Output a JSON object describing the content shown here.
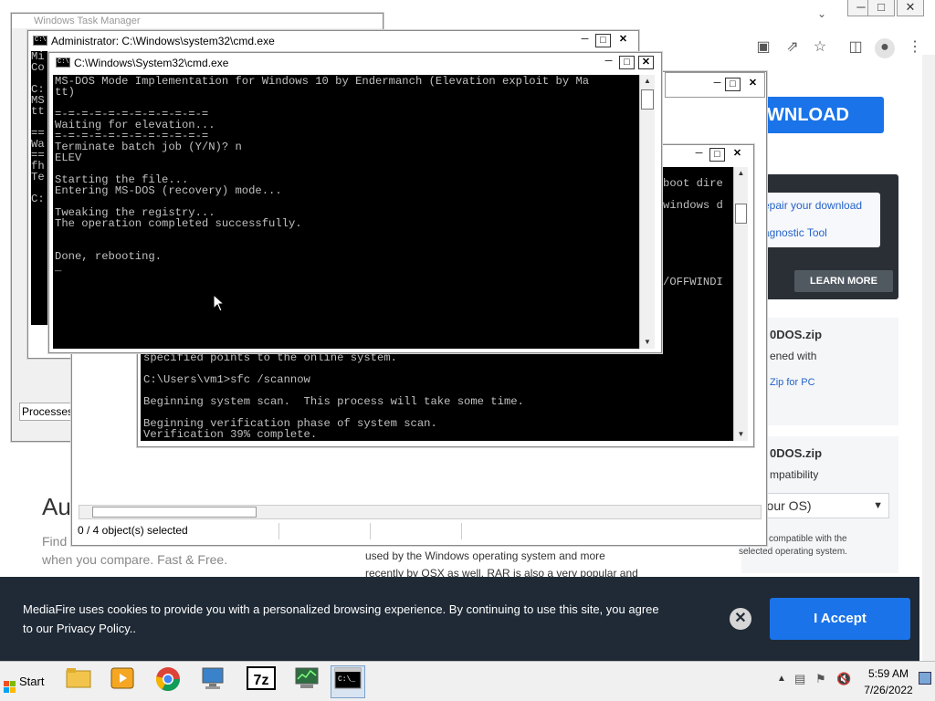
{
  "browser": {
    "download_label": "WNLOAD",
    "repair_link": "epair your download",
    "diag_link": "agnostic Tool",
    "learn_more": "LEARN MORE",
    "card1_title": "0DOS.zip",
    "card1_text": "ened with",
    "card1_link": "Zip for PC",
    "card2_title": "0DOS.zip",
    "card2_text": "mpatibility",
    "os_select": "s (your OS)",
    "compat_note1": "compatible with the",
    "compat_note2": "selected operating system.",
    "left_heading": "Au",
    "left_text1": "Find",
    "left_text2": "when you compare. Fast & Free.",
    "mid_text1": "used by the Windows operating system and more",
    "mid_text2": "recently by OSX as well. RAR is also a very popular and"
  },
  "cookie": {
    "line1": "MediaFire uses cookies to provide you with a personalized browsing experience. By continuing to use this site, you agree",
    "line2": "to our Privacy Policy..",
    "accept": "I Accept"
  },
  "back_windows": {
    "task_manager_title": "Windows Task Manager",
    "processes_label": "Processes:",
    "admin_title": "Administrator: C:\\Windows\\system32\\cmd.exe",
    "admin_console": "Mi\nCo\n\nC:\nMS\ntt\n\n==\nWa\n==\nfh\nTe\n\nC:",
    "explorer_status": "0 / 4 object(s) selected",
    "scan_console": "specified points to the online system.\n\nC:\\Users\\vm1>sfc /scannow\n\nBeginning system scan.  This process will take some time.\n\nBeginning verification phase of system scan.\nVerification 39% complete.",
    "scan_right_console": "boot dire\n\nwindows d\n\n\n\n\n\n\n/OFFWINDI"
  },
  "front_cmd": {
    "title": "C:\\Windows\\System32\\cmd.exe",
    "console": "MS-DOS Mode Implementation for Windows 10 by Endermanch (Elevation exploit by Ma\ntt)\n\n=-=-=-=-=-=-=-=-=-=-=-=\nWaiting for elevation...\n=-=-=-=-=-=-=-=-=-=-=-=\nTerminate batch job (Y/N)? n\nELEV\n\nStarting the file...\nEntering MS-DOS (recovery) mode...\n\nTweaking the registry...\nThe operation completed successfully.\n\n\nDone, rebooting.\n_"
  },
  "taskbar": {
    "start": "Start",
    "time": "5:59 AM",
    "date": "7/26/2022"
  },
  "icons": {
    "minimize": "─",
    "maximize": "□",
    "close": "✕"
  }
}
